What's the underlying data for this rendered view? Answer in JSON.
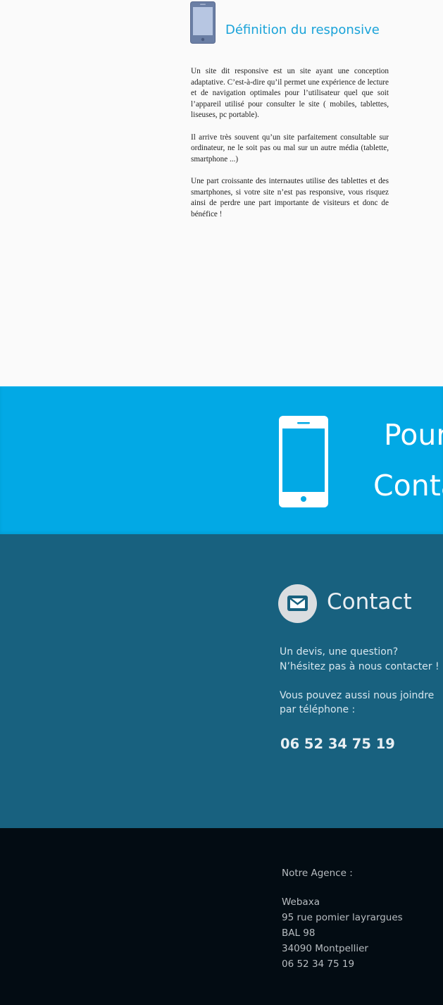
{
  "definition": {
    "title": "Définition du responsive",
    "paragraphs": [
      "Un site dit responsive est un site ayant une conception adaptative. C’est-à-dire qu’il permet une expérience de lecture et de navigation optimales pour l’utilisateur quel que soit l’appareil utilisé pour consulter le site ( mobiles, tablettes, liseuses, pc portable).",
      "Il arrive très souvent qu’un site parfaitement consultable sur ordinateur, ne le soit pas ou mal sur un autre média (tablette, smartphone ...)",
      "Une part croissante des internautes utilise des tablettes et des smartphones, si votre site n’est pas responsive, vous risquez ainsi de perdre une part importante de visiteurs et donc de bénéfice !"
    ]
  },
  "banner": {
    "line1": "Pour",
    "line2": "Conta"
  },
  "contact": {
    "title": "Contact",
    "line1": "Un devis, une question?",
    "line2": "N’hésitez pas à nous contacter !",
    "line3": "Vous pouvez aussi nous joindre",
    "line4": "par téléphone :",
    "phone": "06 52 34 75 19"
  },
  "footer": {
    "heading": "Notre Agence :",
    "company": "Webaxa",
    "street": "95 rue pomier layrargues",
    "box": "BAL 98",
    "city": "34090 Montpellier",
    "phone": "06 52 34 75 19"
  },
  "colors": {
    "accent": "#1aa3d9",
    "banner": "#02a9e5",
    "contact_bg": "#18617f",
    "footer_bg": "#030c13"
  }
}
